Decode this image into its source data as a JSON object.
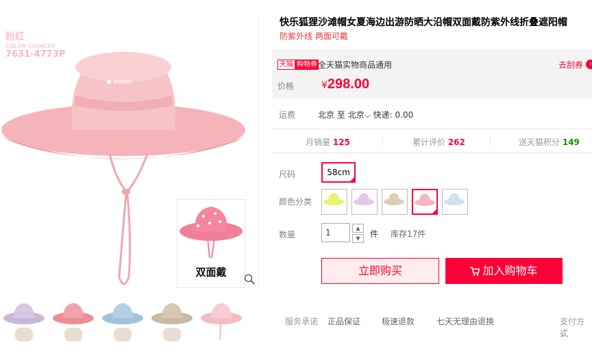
{
  "gallery": {
    "watermark": {
      "color_name": "粉红",
      "color_code": "COLOR CHOICES",
      "model": "7631-4773P"
    },
    "inset_label": "双面戴",
    "zoom_icon": "magnifier-icon",
    "thumb_colors": [
      "#c9b7d8",
      "#f2a2ab",
      "#9ec4d9",
      "#c8b9a3",
      "#f4bcc2"
    ]
  },
  "product": {
    "title": "快乐狐狸沙滩帽女夏海边出游防晒大沿帽双面戴防紫外线折叠遮阳帽",
    "subtitle": "防紫外线 两面可戴"
  },
  "price_box": {
    "tag_brand": "天猫",
    "tag_coupon": "购物券",
    "coupon_text": "全天猫实物商品通用",
    "get_coupon": "去刮券",
    "price_label": "价格",
    "currency": "¥",
    "price": "298.00",
    "accent": "#ff0036"
  },
  "shipping": {
    "label": "运费",
    "from": "北京",
    "to_word": "至",
    "to": "北京",
    "express": "快递: 0.00"
  },
  "stats": {
    "monthly_sales_label": "月销量",
    "monthly_sales": "125",
    "reviews_label": "累计评价",
    "reviews": "262",
    "points_label": "送天猫积分",
    "points": "149"
  },
  "options": {
    "size_label": "尺码",
    "size_value": "58cm",
    "color_label": "颜色分类",
    "colors": [
      "#e8f26a",
      "#e3c6ea",
      "#dccdb5",
      "#f6b6bd",
      "#cfe0ef"
    ],
    "selected_color_index": 3
  },
  "quantity": {
    "label": "数量",
    "value": "1",
    "unit": "件",
    "stock": "库存17件"
  },
  "actions": {
    "buy_now": "立即购买",
    "add_to_cart": "加入购物车"
  },
  "service": {
    "label": "服务承诺",
    "items": [
      "正品保证",
      "极速退款",
      "七天无理由退换"
    ],
    "payment": "支付方式"
  }
}
